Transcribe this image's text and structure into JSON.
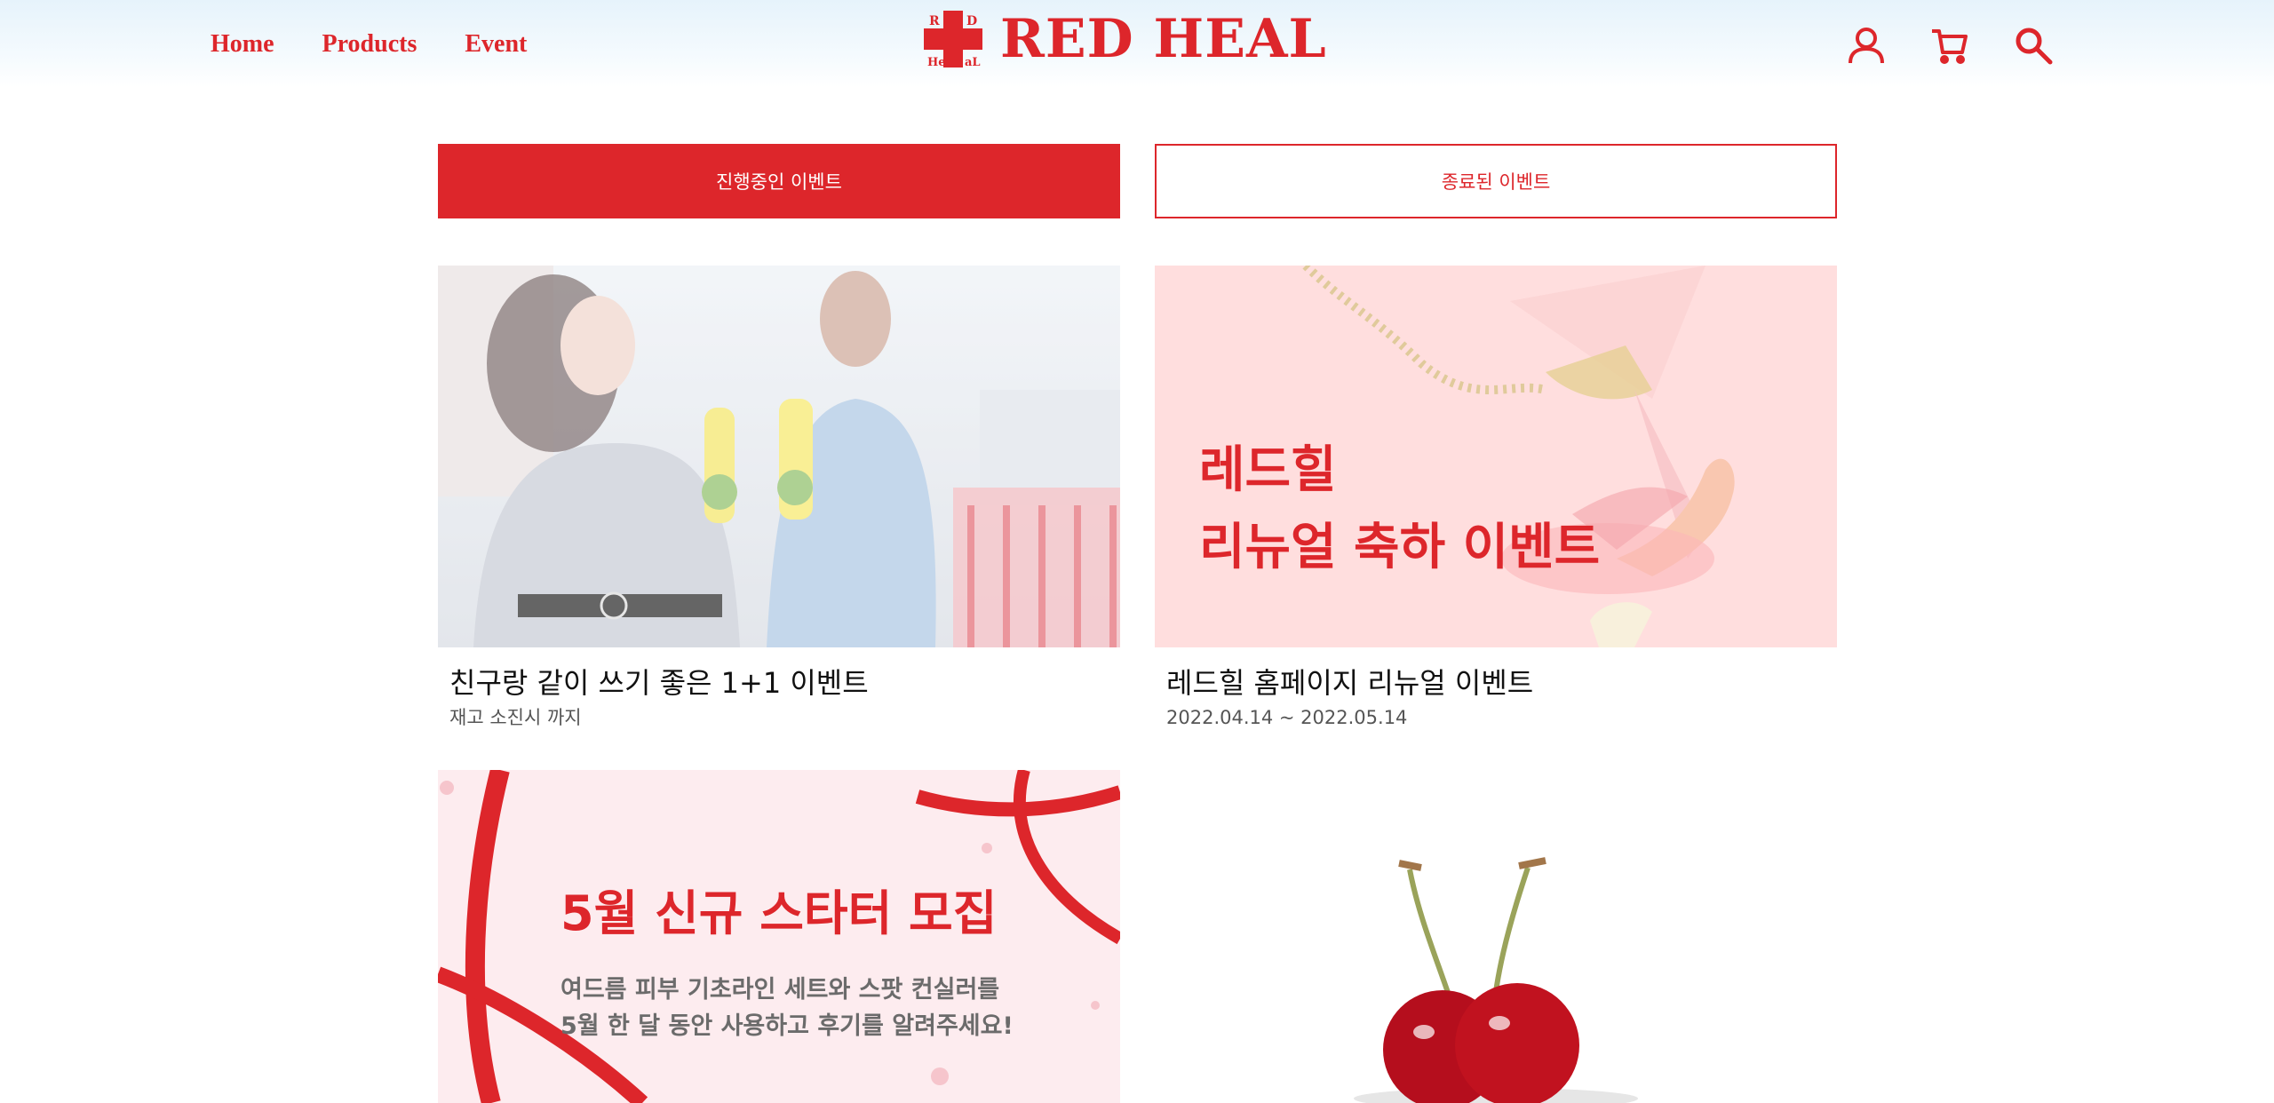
{
  "brand": {
    "name": "RED HEAL",
    "accent": "#dd262b"
  },
  "nav": [
    {
      "label": "Home"
    },
    {
      "label": "Products"
    },
    {
      "label": "Event"
    }
  ],
  "header_icons": [
    "user-icon",
    "cart-icon",
    "search-icon"
  ],
  "tabs": {
    "active": "진행중인 이벤트",
    "inactive": "종료된 이벤트"
  },
  "events": [
    {
      "title": "친구랑 같이 쓰기 좋은 1+1 이벤트",
      "date": "재고 소진시 까지"
    },
    {
      "title": "레드힐 홈페이지 리뉴얼 이벤트",
      "date": "2022.04.14 ~ 2022.05.14",
      "banner_line1": "레드힐",
      "banner_line2": "리뉴얼 축하 이벤트"
    },
    {
      "banner_title": "5월 신규 스타터 모집",
      "banner_desc1": "여드름 피부 기초라인 세트와 스팟 컨실러를",
      "banner_desc2": "5월 한 달 동안 사용하고 후기를 알려주세요!"
    },
    {}
  ]
}
